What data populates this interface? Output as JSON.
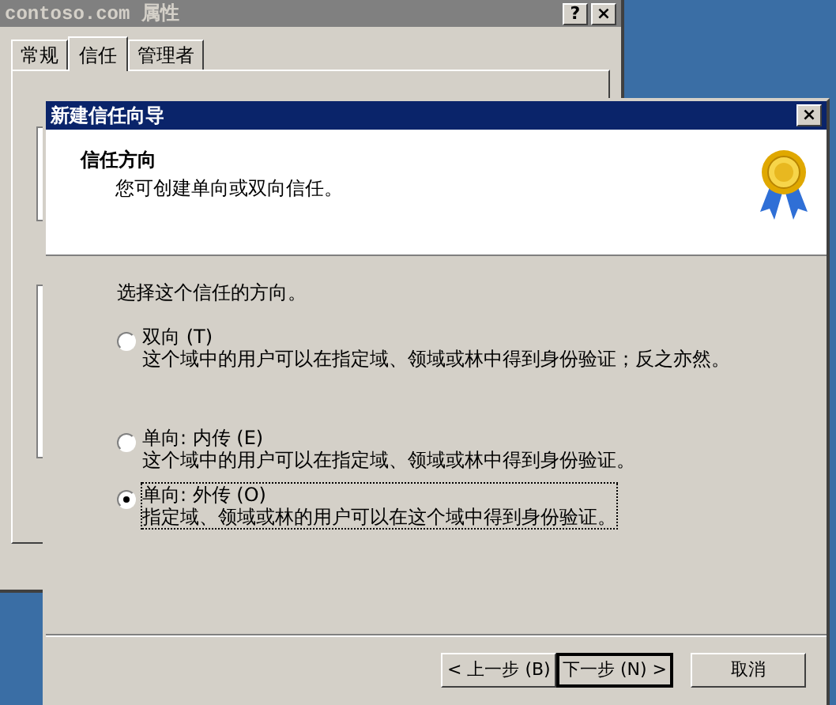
{
  "background_window": {
    "title": "contoso.com 属性",
    "title_buttons": [
      "?",
      "×"
    ],
    "tabs": [
      {
        "label": "常规",
        "selected": false
      },
      {
        "label": "信任",
        "selected": true
      },
      {
        "label": "管理者",
        "selected": false
      }
    ]
  },
  "wizard": {
    "title": "新建信任向导",
    "close": "×",
    "header": {
      "title": "信任方向",
      "subtitle": "您可创建单向或双向信任。"
    },
    "prompt": "选择这个信任的方向。",
    "options": [
      {
        "label": "双向 (T)",
        "description": "这个域中的用户可以在指定域、领域或林中得到身份验证；反之亦然。",
        "selected": false
      },
      {
        "label": "单向: 内传 (E)",
        "description": "这个域中的用户可以在指定域、领域或林中得到身份验证。",
        "selected": false
      },
      {
        "label": "单向: 外传 (O)",
        "description": "指定域、领域或林的用户可以在这个域中得到身份验证。",
        "selected": true
      }
    ],
    "buttons": [
      {
        "label": "< 上一步 (B)",
        "default": false
      },
      {
        "label": "下一步 (N) >",
        "default": true
      },
      {
        "label": "取消",
        "default": false
      }
    ]
  }
}
